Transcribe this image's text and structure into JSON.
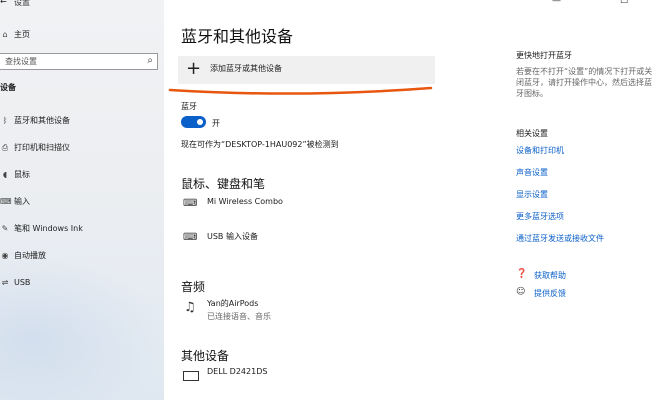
{
  "window": {
    "title": "设置",
    "back_glyph": "←",
    "controls": [
      "—",
      "☐"
    ]
  },
  "sidebar": {
    "home": "主页",
    "search_placeholder": "查找设置",
    "section": "设备",
    "items": [
      {
        "icon": "bluetooth-icon",
        "glyph": "ᛒ",
        "label": "蓝牙和其他设备"
      },
      {
        "icon": "printer-icon",
        "glyph": "⎙",
        "label": "打印机和扫描仪"
      },
      {
        "icon": "mouse-icon",
        "glyph": "◖",
        "label": "鼠标"
      },
      {
        "icon": "keyboard-icon",
        "glyph": "⌨",
        "label": "输入"
      },
      {
        "icon": "pen-icon",
        "glyph": "✎",
        "label": "笔和 Windows Ink"
      },
      {
        "icon": "autoplay-icon",
        "glyph": "◉",
        "label": "自动播放"
      },
      {
        "icon": "usb-icon",
        "glyph": "⇌",
        "label": "USB"
      }
    ]
  },
  "main": {
    "title": "蓝牙和其他设备",
    "add_device_label": "添加蓝牙或其他设备",
    "bluetooth": {
      "heading": "蓝牙",
      "toggle_state": "开",
      "toggle_on": true,
      "discoverable_text": "现在可作为“DESKTOP-1HAU092”被检测到"
    },
    "mouse_section": {
      "heading": "鼠标、键盘和笔",
      "devices": [
        {
          "icon": "keyboard-icon",
          "name": "Mi Wireless Combo"
        },
        {
          "icon": "keyboard-icon",
          "name": "USB 输入设备"
        }
      ]
    },
    "audio_section": {
      "heading": "音频",
      "devices": [
        {
          "icon": "headphones-icon",
          "name": "Yan的AirPods",
          "status": "已连接语音、音乐"
        }
      ]
    },
    "other_section": {
      "heading": "其他设备",
      "devices": [
        {
          "icon": "monitor-icon",
          "name": "DELL D2421DS"
        }
      ]
    }
  },
  "right": {
    "faster_title": "更快地打开蓝牙",
    "faster_text_lines": [
      "若要在不打开“设置”的情况下打开或关",
      "闭蓝牙，请打开操作中心，然后选择蓝",
      "牙图标。"
    ],
    "related_title": "相关设置",
    "related_links": [
      "设备和打印机",
      "声音设置",
      "显示设置",
      "更多蓝牙选项",
      "通过蓝牙发送或接收文件"
    ],
    "help_link": "获取帮助",
    "feedback_link": "提供反馈"
  },
  "colors": {
    "accent": "#0a5fc8",
    "annotation_line": "#e8560f"
  }
}
